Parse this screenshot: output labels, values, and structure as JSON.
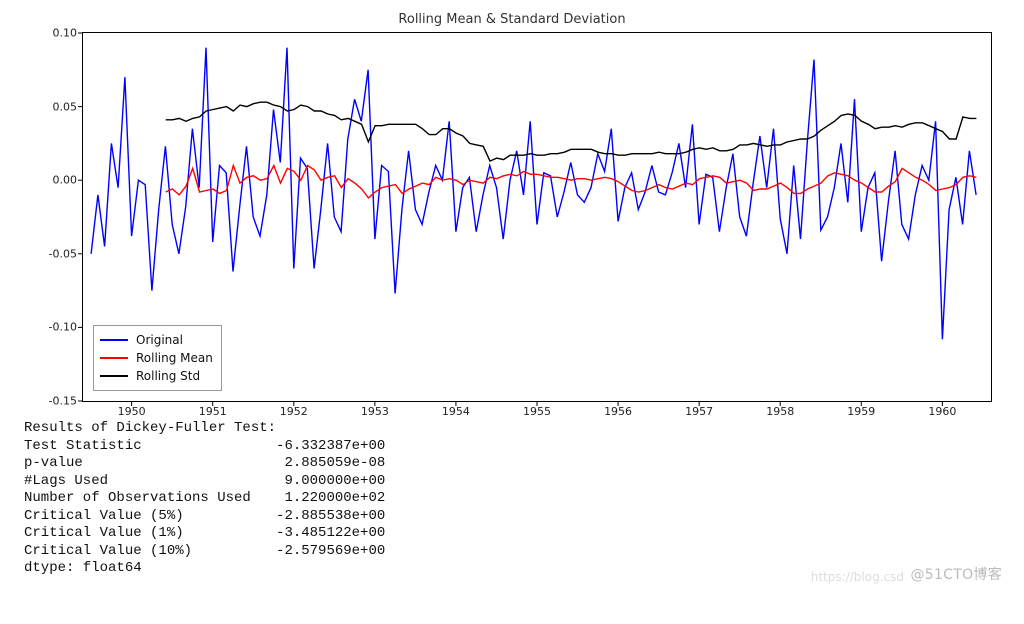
{
  "chart_data": {
    "type": "line",
    "title": "Rolling Mean & Standard Deviation",
    "xlabel": "",
    "ylabel": "",
    "xlim": [
      1949.4,
      1960.6
    ],
    "ylim": [
      -0.15,
      0.1
    ],
    "yticks": [
      -0.15,
      -0.1,
      -0.05,
      0.0,
      0.05,
      0.1
    ],
    "xticks": [
      1950,
      1951,
      1952,
      1953,
      1954,
      1955,
      1956,
      1957,
      1958,
      1959,
      1960
    ],
    "legend_position": "lower left",
    "series": [
      {
        "name": "Original",
        "color": "#0000ff",
        "x_step_monthly_from": 1949.5,
        "values": [
          -0.05,
          -0.01,
          -0.045,
          0.025,
          -0.005,
          0.07,
          -0.038,
          0.0,
          -0.003,
          -0.075,
          -0.02,
          0.023,
          -0.03,
          -0.05,
          -0.018,
          0.035,
          -0.005,
          0.09,
          -0.042,
          0.01,
          0.005,
          -0.062,
          -0.018,
          0.023,
          -0.025,
          -0.038,
          -0.01,
          0.048,
          0.012,
          0.09,
          -0.06,
          0.015,
          0.008,
          -0.06,
          -0.02,
          0.025,
          -0.025,
          -0.035,
          0.028,
          0.055,
          0.04,
          0.075,
          -0.04,
          0.01,
          0.006,
          -0.077,
          -0.02,
          0.02,
          -0.02,
          -0.03,
          -0.008,
          0.01,
          0.0,
          0.04,
          -0.035,
          -0.005,
          0.002,
          -0.035,
          -0.01,
          0.01,
          -0.005,
          -0.04,
          0.0,
          0.02,
          -0.01,
          0.04,
          -0.03,
          0.005,
          0.003,
          -0.025,
          -0.008,
          0.012,
          -0.01,
          -0.015,
          -0.005,
          0.018,
          0.006,
          0.035,
          -0.028,
          -0.005,
          0.005,
          -0.02,
          -0.008,
          0.01,
          -0.008,
          -0.01,
          0.005,
          0.025,
          -0.005,
          0.038,
          -0.03,
          0.004,
          0.002,
          -0.035,
          -0.005,
          0.018,
          -0.025,
          -0.038,
          -0.002,
          0.03,
          -0.005,
          0.035,
          -0.026,
          -0.05,
          0.01,
          -0.04,
          0.025,
          0.082,
          -0.034,
          -0.025,
          -0.005,
          0.025,
          -0.015,
          0.055,
          -0.035,
          -0.005,
          0.005,
          -0.055,
          -0.015,
          0.02,
          -0.03,
          -0.04,
          -0.01,
          0.01,
          0.0,
          0.04,
          -0.108,
          -0.02,
          0.002,
          -0.03,
          0.02,
          -0.01
        ]
      },
      {
        "name": "Rolling Mean",
        "color": "#ff0000",
        "x_step_monthly_from": 1950.42,
        "values": [
          -0.008,
          -0.006,
          -0.01,
          -0.004,
          0.008,
          -0.008,
          -0.007,
          -0.006,
          -0.009,
          -0.007,
          0.01,
          -0.002,
          0.002,
          0.003,
          0.0,
          0.001,
          0.01,
          -0.002,
          0.008,
          0.006,
          0.0,
          0.01,
          0.007,
          0.0,
          0.002,
          0.003,
          -0.005,
          0.001,
          -0.002,
          -0.006,
          -0.012,
          -0.008,
          -0.005,
          -0.004,
          -0.003,
          -0.009,
          -0.006,
          -0.004,
          -0.002,
          -0.003,
          0.002,
          0.0,
          0.001,
          0.0,
          -0.003,
          0.0,
          -0.001,
          -0.002,
          0.002,
          0.001,
          0.003,
          0.004,
          0.003,
          0.006,
          0.004,
          0.004,
          0.003,
          0.002,
          0.002,
          0.001,
          0.0,
          0.001,
          0.001,
          0.0,
          0.001,
          0.002,
          0.001,
          -0.001,
          -0.004,
          -0.007,
          -0.008,
          -0.007,
          -0.005,
          -0.003,
          -0.005,
          -0.006,
          -0.004,
          -0.002,
          -0.003,
          0.001,
          0.002,
          0.003,
          0.002,
          -0.002,
          -0.001,
          0.0,
          -0.002,
          -0.007,
          -0.006,
          -0.006,
          -0.004,
          -0.002,
          -0.005,
          -0.009,
          -0.009,
          -0.006,
          -0.004,
          -0.002,
          0.003,
          0.005,
          0.004,
          0.003,
          0.0,
          -0.002,
          -0.005,
          -0.008,
          -0.008,
          -0.004,
          -0.001,
          0.008,
          0.005,
          0.002,
          0.0,
          -0.003,
          -0.007,
          -0.006,
          -0.005,
          -0.003,
          0.002,
          0.003,
          0.002
        ]
      },
      {
        "name": "Rolling Std",
        "color": "#000000",
        "x_step_monthly_from": 1950.42,
        "values": [
          0.041,
          0.041,
          0.042,
          0.04,
          0.042,
          0.043,
          0.047,
          0.048,
          0.049,
          0.05,
          0.047,
          0.051,
          0.05,
          0.052,
          0.053,
          0.053,
          0.051,
          0.05,
          0.047,
          0.048,
          0.051,
          0.05,
          0.047,
          0.047,
          0.045,
          0.044,
          0.041,
          0.042,
          0.04,
          0.038,
          0.026,
          0.037,
          0.037,
          0.038,
          0.038,
          0.038,
          0.038,
          0.038,
          0.035,
          0.031,
          0.031,
          0.035,
          0.035,
          0.032,
          0.03,
          0.025,
          0.024,
          0.023,
          0.013,
          0.015,
          0.014,
          0.017,
          0.017,
          0.017,
          0.018,
          0.017,
          0.017,
          0.018,
          0.018,
          0.019,
          0.021,
          0.021,
          0.021,
          0.021,
          0.019,
          0.018,
          0.018,
          0.017,
          0.017,
          0.018,
          0.018,
          0.018,
          0.018,
          0.019,
          0.018,
          0.018,
          0.018,
          0.019,
          0.021,
          0.022,
          0.021,
          0.022,
          0.02,
          0.02,
          0.021,
          0.024,
          0.024,
          0.025,
          0.024,
          0.023,
          0.024,
          0.024,
          0.026,
          0.027,
          0.028,
          0.028,
          0.03,
          0.034,
          0.037,
          0.04,
          0.044,
          0.045,
          0.044,
          0.04,
          0.038,
          0.035,
          0.036,
          0.036,
          0.037,
          0.036,
          0.038,
          0.039,
          0.039,
          0.037,
          0.035,
          0.033,
          0.028,
          0.028,
          0.043,
          0.042,
          0.042
        ]
      }
    ]
  },
  "legend": {
    "items": [
      "Original",
      "Rolling Mean",
      "Rolling Std"
    ]
  },
  "results": {
    "header": "Results of Dickey-Fuller Test:",
    "rows": [
      [
        "Test Statistic",
        "-6.332387e+00"
      ],
      [
        "p-value",
        "2.885059e-08"
      ],
      [
        "#Lags Used",
        "9.000000e+00"
      ],
      [
        "Number of Observations Used",
        "1.220000e+02"
      ],
      [
        "Critical Value (5%)",
        "-2.885538e+00"
      ],
      [
        "Critical Value (1%)",
        "-3.485122e+00"
      ],
      [
        "Critical Value (10%)",
        "-2.579569e+00"
      ]
    ],
    "dtype": "dtype: float64"
  },
  "watermark": "@51CTO博客",
  "watermark2": "https://blog.csd"
}
